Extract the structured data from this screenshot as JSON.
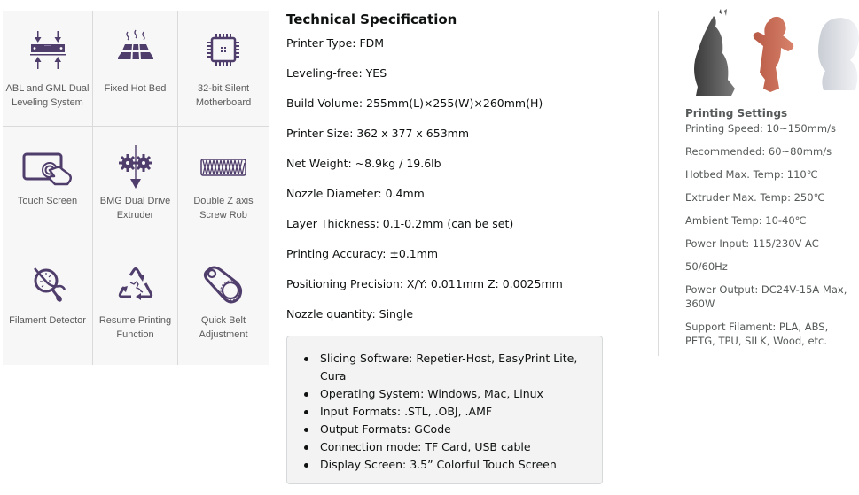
{
  "features": [
    {
      "label": "ABL and GML Dual Leveling System",
      "icon": "leveling-icon"
    },
    {
      "label": "Fixed Hot Bed",
      "icon": "hot-bed-icon"
    },
    {
      "label": "32-bit Silent Motherboard",
      "icon": "chip-icon"
    },
    {
      "label": "Touch Screen",
      "icon": "touch-screen-icon"
    },
    {
      "label": "BMG Dual Drive Extruder",
      "icon": "gears-extruder-icon"
    },
    {
      "label": "Double Z axis Screw Rob",
      "icon": "screw-rod-icon"
    },
    {
      "label": "Filament Detector",
      "icon": "filament-detector-icon"
    },
    {
      "label": "Resume Printing Function",
      "icon": "recycle-resume-icon"
    },
    {
      "label": "Quick Belt Adjustment",
      "icon": "belt-icon"
    }
  ],
  "spec": {
    "title": "Technical Specification",
    "rows": [
      "Printer Type: FDM",
      "Leveling-free: YES",
      "Build Volume: 255mm(L)×255(W)×260mm(H)",
      "Printer Size: 362 x 377 x 653mm",
      "Net Weight: ~8.9kg / 19.6lb",
      "Nozzle Diameter: 0.4mm",
      "Layer Thickness: 0.1-0.2mm (can be set)",
      "Printing Accuracy: ±0.1mm",
      "Positioning Precision: X/Y: 0.011mm Z: 0.0025mm",
      "Nozzle quantity: Single"
    ],
    "bullets": [
      "Slicing Software: Repetier-Host, EasyPrint Lite, Cura",
      "Operating System: Windows, Mac, Linux",
      "Input Formats: .STL, .OBJ, .AMF",
      "Output Formats: GCode",
      "Connection mode: TF Card, USB cable",
      "Display Screen: 3.5” Colorful Touch Screen"
    ]
  },
  "settings": {
    "title": "Printing Settings",
    "rows": [
      "Printing Speed: 10~150mm/s",
      "Recommended: 60~80mm/s",
      "Hotbed Max. Temp: 110℃",
      "Extruder Max. Temp: 250℃",
      "Ambient Temp: 10-40℃",
      "Power Input: 115/230V AC",
      "50/60Hz",
      "Power Output: DC24V-15A Max, 360W",
      "Support Filament: PLA, ABS, PETG, TPU, SILK, Wood, etc."
    ]
  },
  "colors": {
    "icon": "#4f3d6b",
    "grid_bg": "#f7f7f7",
    "box_bg": "#f3f3f3"
  }
}
